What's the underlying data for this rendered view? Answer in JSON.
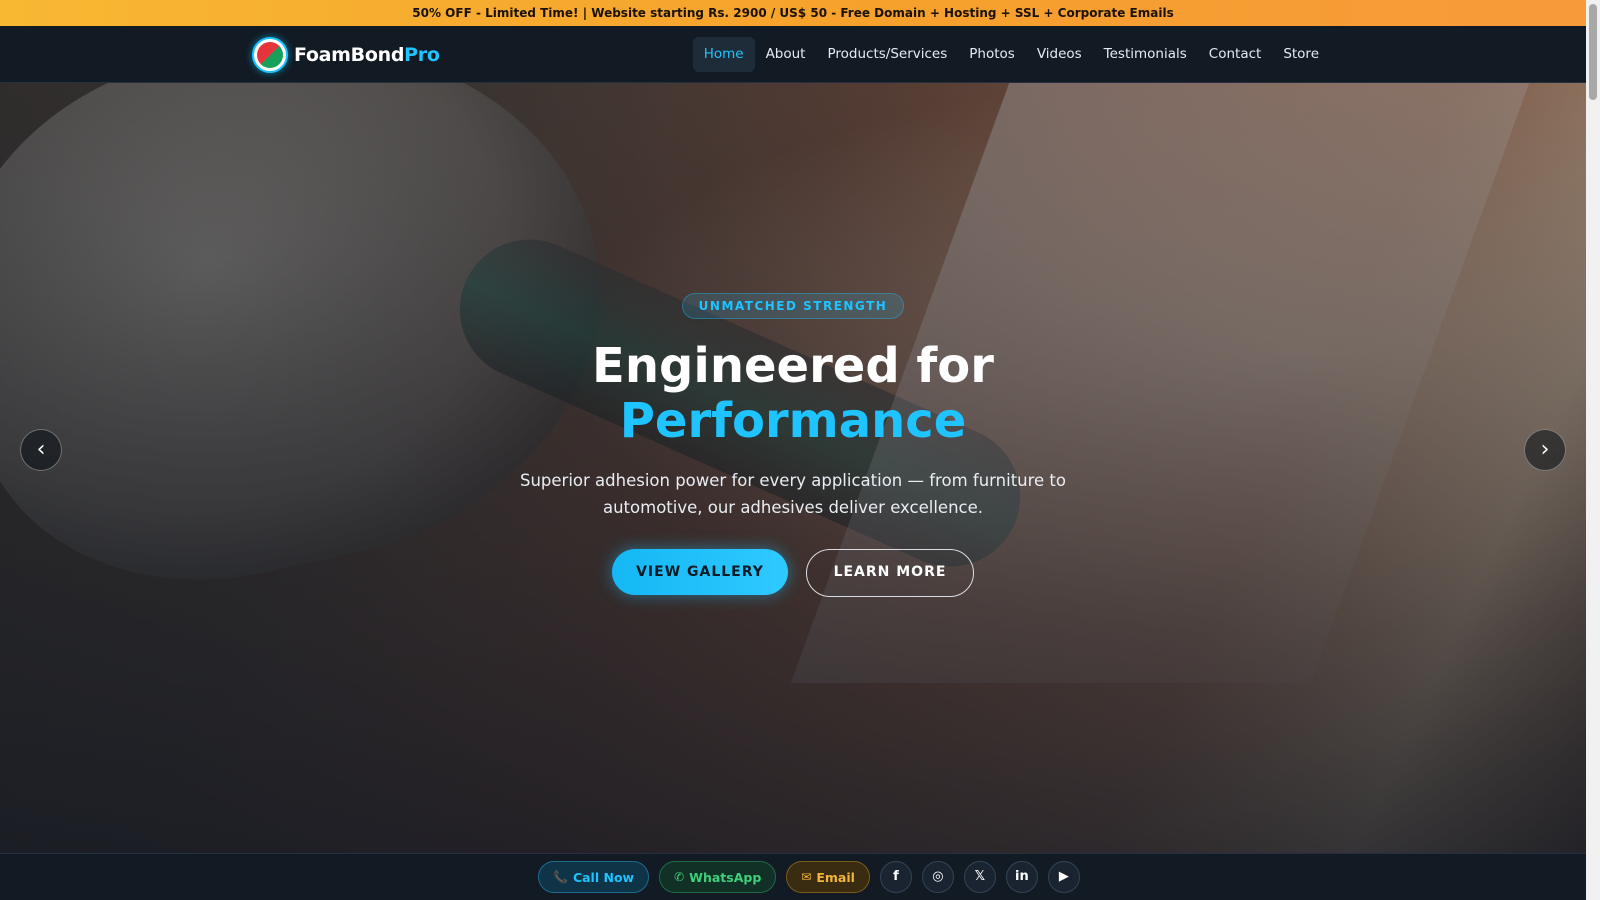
{
  "promo": {
    "text": "50% OFF - Limited Time! | Website starting Rs. 2900 / US$ 50 - Free Domain + Hosting + SSL + Corporate Emails"
  },
  "brand": {
    "name_main": "FoamBond",
    "name_accent": "Pro"
  },
  "nav": {
    "items": [
      {
        "label": "Home",
        "active": true
      },
      {
        "label": "About"
      },
      {
        "label": "Products/Services"
      },
      {
        "label": "Photos"
      },
      {
        "label": "Videos"
      },
      {
        "label": "Testimonials"
      },
      {
        "label": "Contact"
      },
      {
        "label": "Store"
      }
    ]
  },
  "hero": {
    "badge": "UNMATCHED STRENGTH",
    "headline": "Engineered for",
    "headline_accent": "Performance",
    "subtitle": "Superior adhesion power for every application — from furniture to automotive, our adhesives deliver excellence.",
    "primary_cta": "VIEW GALLERY",
    "secondary_cta": "LEARN MORE",
    "prev_arrow": "‹",
    "next_arrow": "›"
  },
  "contact_bar": {
    "call_icon": "📞",
    "call": "Call Now",
    "whatsapp_icon": "✆",
    "whatsapp": "WhatsApp",
    "email_icon": "✉",
    "email": "Email",
    "socials": [
      {
        "icon": "f",
        "name": "facebook-icon"
      },
      {
        "icon": "◎",
        "name": "instagram-icon"
      },
      {
        "icon": "𝕏",
        "name": "x-icon"
      },
      {
        "icon": "in",
        "name": "linkedin-icon"
      },
      {
        "icon": "▶",
        "name": "youtube-icon"
      }
    ]
  },
  "colors": {
    "accent": "#1ec3ff",
    "promo": "#f6a12c",
    "nav_bg": "#121a23"
  }
}
